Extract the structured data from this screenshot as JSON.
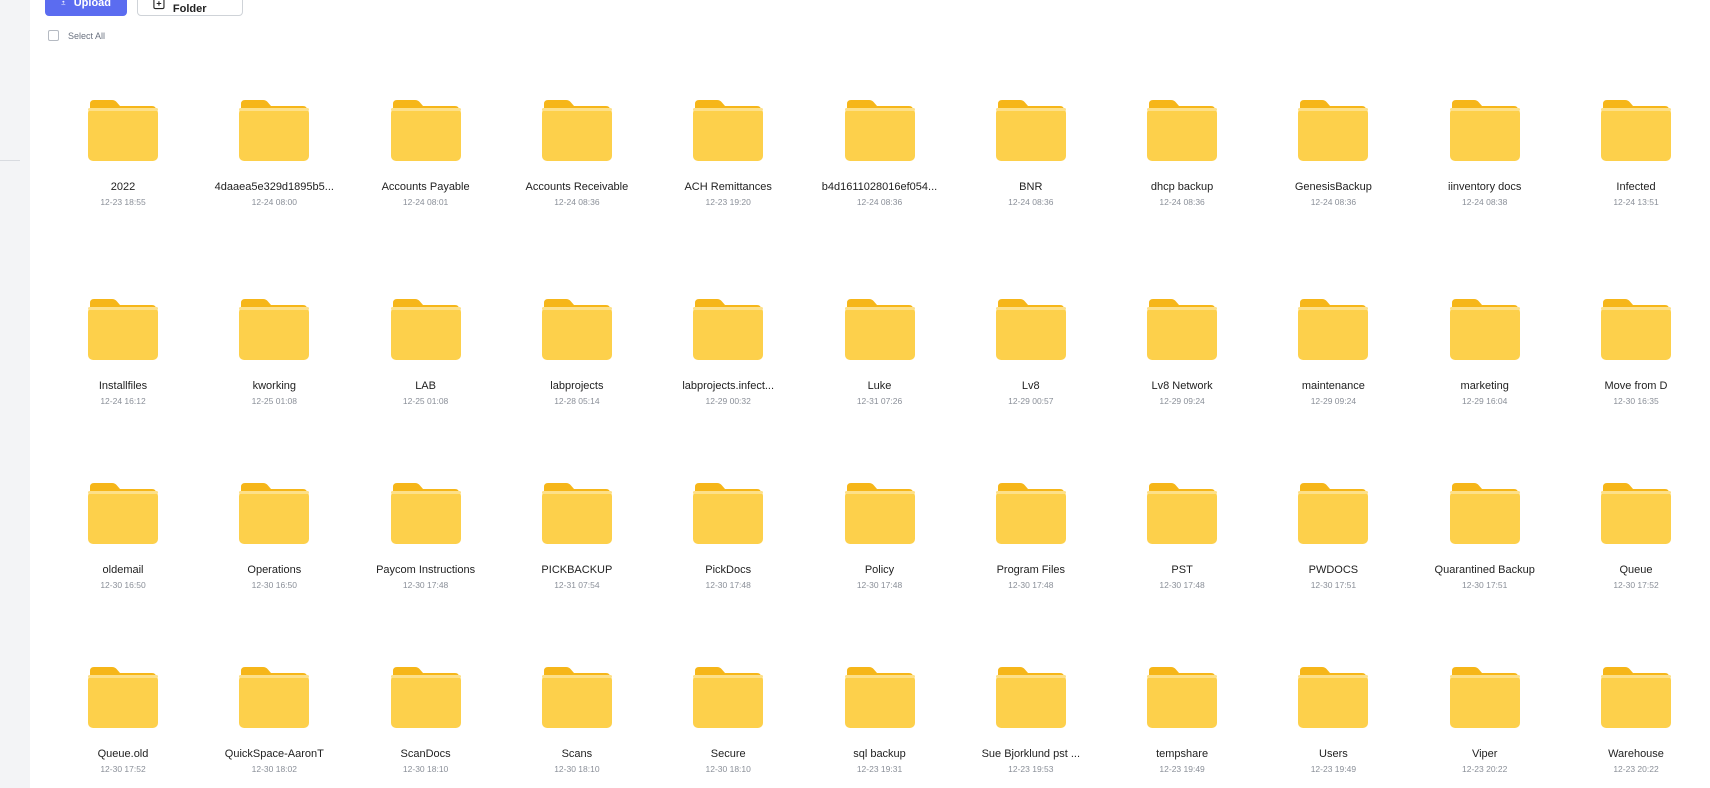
{
  "toolbar": {
    "upload_label": "Upload",
    "new_folder_label": "New Folder",
    "accent_color": "#5b6cf0"
  },
  "select_all_label": "Select All",
  "folders": [
    [
      {
        "name": "2022",
        "date": "12-23 18:55"
      },
      {
        "name": "4daaea5e329d1895b5...",
        "date": "12-24 08:00"
      },
      {
        "name": "Accounts Payable",
        "date": "12-24 08:01"
      },
      {
        "name": "Accounts Receivable",
        "date": "12-24 08:36"
      },
      {
        "name": "ACH Remittances",
        "date": "12-23 19:20"
      },
      {
        "name": "b4d1611028016ef054...",
        "date": "12-24 08:36"
      },
      {
        "name": "BNR",
        "date": "12-24 08:36"
      },
      {
        "name": "dhcp backup",
        "date": "12-24 08:36"
      },
      {
        "name": "GenesisBackup",
        "date": "12-24 08:36"
      },
      {
        "name": "iinventory docs",
        "date": "12-24 08:38"
      },
      {
        "name": "Infected",
        "date": "12-24 13:51"
      }
    ],
    [
      {
        "name": "Installfiles",
        "date": "12-24 16:12"
      },
      {
        "name": "kworking",
        "date": "12-25 01:08"
      },
      {
        "name": "LAB",
        "date": "12-25 01:08"
      },
      {
        "name": "labprojects",
        "date": "12-28 05:14"
      },
      {
        "name": "labprojects.infect...",
        "date": "12-29 00:32"
      },
      {
        "name": "Luke",
        "date": "12-31 07:26"
      },
      {
        "name": "Lv8",
        "date": "12-29 00:57"
      },
      {
        "name": "Lv8 Network",
        "date": "12-29 09:24"
      },
      {
        "name": "maintenance",
        "date": "12-29 09:24"
      },
      {
        "name": "marketing",
        "date": "12-29 16:04"
      },
      {
        "name": "Move from D",
        "date": "12-30 16:35"
      }
    ],
    [
      {
        "name": "oldemail",
        "date": "12-30 16:50"
      },
      {
        "name": "Operations",
        "date": "12-30 16:50"
      },
      {
        "name": "Paycom Instructions",
        "date": "12-30 17:48"
      },
      {
        "name": "PICKBACKUP",
        "date": "12-31 07:54"
      },
      {
        "name": "PickDocs",
        "date": "12-30 17:48"
      },
      {
        "name": "Policy",
        "date": "12-30 17:48"
      },
      {
        "name": "Program Files",
        "date": "12-30 17:48"
      },
      {
        "name": "PST",
        "date": "12-30 17:48"
      },
      {
        "name": "PWDOCS",
        "date": "12-30 17:51"
      },
      {
        "name": "Quarantined Backup",
        "date": "12-30 17:51"
      },
      {
        "name": "Queue",
        "date": "12-30 17:52"
      }
    ],
    [
      {
        "name": "Queue.old",
        "date": "12-30 17:52"
      },
      {
        "name": "QuickSpace-AaronT",
        "date": "12-30 18:02"
      },
      {
        "name": "ScanDocs",
        "date": "12-30 18:10"
      },
      {
        "name": "Scans",
        "date": "12-30 18:10"
      },
      {
        "name": "Secure",
        "date": "12-30 18:10"
      },
      {
        "name": "sql backup",
        "date": "12-23 19:31"
      },
      {
        "name": "Sue Bjorklund pst ...",
        "date": "12-23 19:53"
      },
      {
        "name": "tempshare",
        "date": "12-23 19:49"
      },
      {
        "name": "Users",
        "date": "12-23 19:49"
      },
      {
        "name": "Viper",
        "date": "12-23 20:22"
      },
      {
        "name": "Warehouse",
        "date": "12-23 20:22"
      }
    ]
  ],
  "icons": {
    "folder": "folder-icon",
    "upload": "upload-icon",
    "new_folder": "new-folder-icon"
  }
}
